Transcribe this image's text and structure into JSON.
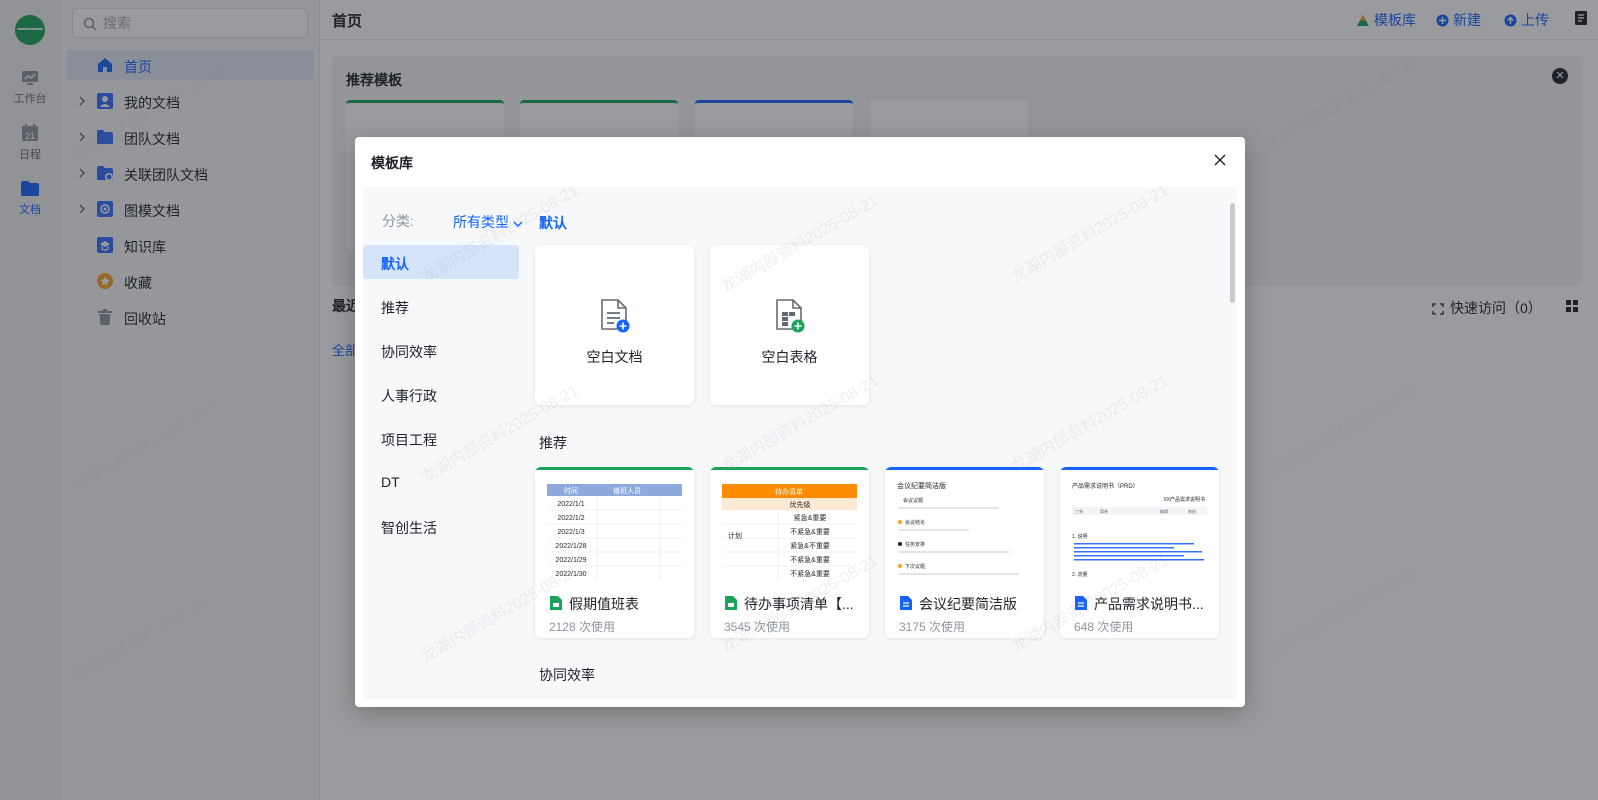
{
  "rail": {
    "avatar_text": "一一",
    "items": [
      {
        "label": "工作台",
        "icon": "workbench-icon"
      },
      {
        "label": "日程",
        "icon": "calendar-icon"
      },
      {
        "label": "文档",
        "icon": "folder-icon"
      }
    ]
  },
  "sidebar": {
    "search_placeholder": "搜索",
    "items": [
      {
        "label": "首页",
        "icon": "home-icon"
      },
      {
        "label": "我的文档",
        "icon": "my-docs-icon"
      },
      {
        "label": "团队文档",
        "icon": "team-folder-icon"
      },
      {
        "label": "关联团队文档",
        "icon": "linked-team-icon"
      },
      {
        "label": "图模文档",
        "icon": "graph-docs-icon"
      },
      {
        "label": "知识库",
        "icon": "knowledge-base-icon"
      },
      {
        "label": "收藏",
        "icon": "star-icon"
      },
      {
        "label": "回收站",
        "icon": "trash-icon"
      }
    ]
  },
  "header": {
    "title": "首页",
    "actions": {
      "template_lib": "模板库",
      "new": "新建",
      "upload": "上传"
    }
  },
  "recommend_panel": {
    "title": "推荐模板"
  },
  "recent": {
    "label": "最近",
    "all_label": "全部",
    "quick_access": "快速访问（0）"
  },
  "modal": {
    "title": "模板库",
    "category_label": "分类:",
    "type_select": "所有类型",
    "categories": [
      "默认",
      "推荐",
      "协同效率",
      "人事行政",
      "项目工程",
      "DT",
      "智创生活"
    ],
    "section_default": "默认",
    "blank_doc": "空白文档",
    "blank_sheet": "空白表格",
    "section_recommend": "推荐",
    "templates": [
      {
        "name": "假期值班表",
        "uses": "2128 次使用",
        "type": "sheet"
      },
      {
        "name": "待办事项清单【...",
        "uses": "3545 次使用",
        "type": "sheet"
      },
      {
        "name": "会议纪要简洁版",
        "uses": "3175 次使用",
        "type": "doc"
      },
      {
        "name": "产品需求说明书...",
        "uses": "648 次使用",
        "type": "doc"
      }
    ],
    "section_efficiency": "协同效率",
    "thumb_texts": {
      "duty_headers": [
        "时间",
        "值班人员"
      ],
      "duty_dates": [
        "2022/1/1",
        "2022/1/2",
        "2022/1/3",
        "2022/1/28",
        "2022/1/29",
        "2022/1/30"
      ],
      "todo_title": "待办清单",
      "todo_priority": "优先级",
      "todo_plan": "计划",
      "todo_rows": [
        "紧急&重要",
        "不紧急&重要",
        "紧急&不重要",
        "不紧急&重要",
        "不紧急&重要"
      ],
      "meeting_title": "会议纪要简洁版",
      "meeting_items": [
        "会议议题",
        "会议结论",
        "任务安排",
        "下次议题"
      ],
      "prd_title": "产品需求说明书（PRD）",
      "prd_subtitle": "XX产品需求说明书",
      "prd_headers": [
        "工单",
        "简单",
        "编辑",
        "审核"
      ],
      "prd_items": [
        "1. 说明",
        "2. 流量"
      ]
    }
  },
  "watermark_text": "龙湖内部资料2025-08-21",
  "colors": {
    "accent": "#1664ff",
    "green": "#1aa35a",
    "orange": "#ff8c00"
  }
}
